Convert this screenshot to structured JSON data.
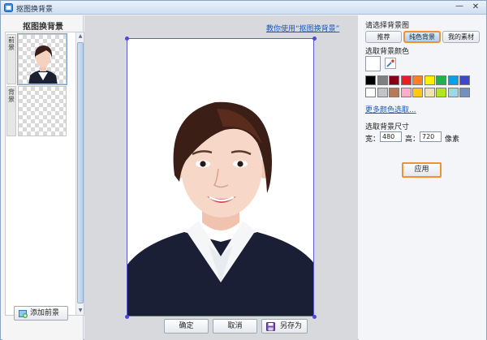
{
  "window": {
    "title": "抠图换背景"
  },
  "left_panel": {
    "title": "抠图换背景",
    "layers": [
      {
        "label": "前景"
      },
      {
        "label": "背景"
      }
    ],
    "add_foreground_label": "添加前景"
  },
  "canvas": {
    "tutorial_link": "教你使用“抠图换背景”"
  },
  "bottom_buttons": {
    "confirm": "确定",
    "cancel": "取消",
    "save_as": "另存为"
  },
  "right_panel": {
    "title": "请选择背景图",
    "tabs": [
      {
        "label": "推荐",
        "active": false
      },
      {
        "label": "纯色背景",
        "active": true
      },
      {
        "label": "我的素材",
        "active": false
      }
    ],
    "color_section_label": "选取背景颜色",
    "current_color": "#ffffff",
    "palette": [
      "#000000",
      "#7f7f7f",
      "#880015",
      "#ed1c24",
      "#ff7f27",
      "#fff200",
      "#22b14c",
      "#00a2e8",
      "#3f48cc",
      "#ffffff",
      "#c3c3c3",
      "#b97a57",
      "#ffaec9",
      "#ffc90e",
      "#efe4b0",
      "#b5e61d",
      "#99d9ea",
      "#7092be"
    ],
    "more_colors_link": "更多颜色选取...",
    "size_section_label": "选取背景尺寸",
    "width_label": "宽：",
    "width_value": "480",
    "height_label": "高：",
    "height_value": "720",
    "unit_label": "像素",
    "apply_label": "应用"
  },
  "colors": {
    "accent_orange": "#f09133",
    "link_blue": "#1d58c0",
    "selection_blue": "#5a5ad6"
  }
}
